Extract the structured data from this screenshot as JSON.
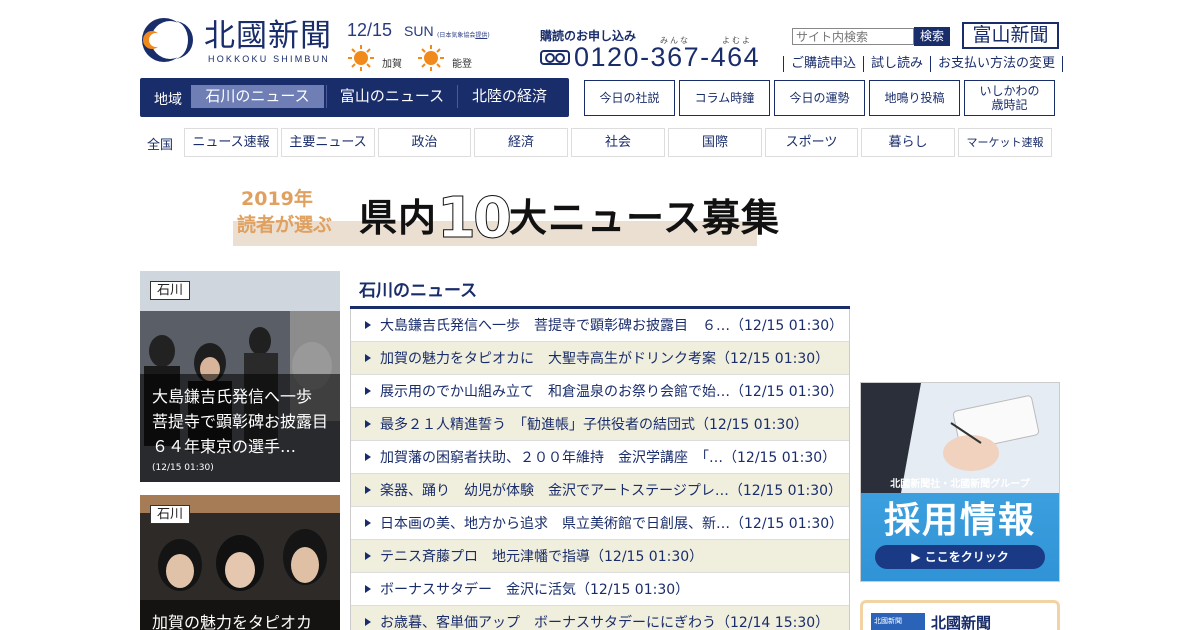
{
  "header": {
    "logo_text": "北國新聞",
    "logo_sub": "HOKKOKU SHIMBUN",
    "date": "12/15",
    "weekday": "SUN",
    "weather_source_prefix": "(日本気象協会",
    "weather_source_link": "提供",
    "weather_source_suffix": ")",
    "weather": [
      {
        "region": "加賀",
        "icon": "sun-icon"
      },
      {
        "region": "能登",
        "icon": "sun-icon"
      }
    ],
    "subscribe_label": "購読のお申し込み",
    "phone_ruby_1": "みんな",
    "phone_ruby_2": "よむよ",
    "phone": "0120-367-464",
    "search_placeholder": "サイト内検索",
    "search_button": "検索",
    "toyama_button": "富山新聞",
    "top_links": [
      "ご購読申込",
      "試し読み",
      "お支払い方法の変更"
    ]
  },
  "region_nav": {
    "label": "地域",
    "tabs": [
      "石川のニュース",
      "富山のニュース",
      "北陸の経済"
    ],
    "active_index": 0
  },
  "feature_buttons": [
    "今日の社説",
    "コラム時鐘",
    "今日の運勢",
    "地鳴り投稿",
    "いしかわの\n歳時記"
  ],
  "category_nav": {
    "label": "全国",
    "items": [
      "ニュース速報",
      "主要ニュース",
      "政治",
      "経済",
      "社会",
      "国際",
      "スポーツ",
      "暮らし",
      "マーケット速報"
    ]
  },
  "banner": {
    "year": "2019年",
    "sub": "読者が選ぶ",
    "main_prefix": "県内",
    "main_number": "10",
    "main_suffix": "大ニュース募集"
  },
  "photo_cards": [
    {
      "tag": "石川",
      "caption": "大島鎌吉氏発信へ一歩　菩提寺で顕彰碑お披露目　６４年東京の選手…",
      "time": "(12/15 01:30)"
    },
    {
      "tag": "石川",
      "caption": "加賀の魅力をタピオカ",
      "time": ""
    }
  ],
  "news": {
    "heading": "石川のニュース",
    "items": [
      "大島鎌吉氏発信へ一歩　菩提寺で顕彰碑お披露目　６…（12/15 01:30）",
      "加賀の魅力をタピオカに　大聖寺高生がドリンク考案（12/15 01:30）",
      "展示用のでか山組み立て　和倉温泉のお祭り会館で始…（12/15 01:30）",
      "最多２１人精進誓う　「勧進帳」子供役者の結団式（12/15 01:30）",
      "加賀藩の困窮者扶助、２００年維持　金沢学講座　「…（12/15 01:30）",
      "楽器、踊り　幼児が体験　金沢でアートステージプレ…（12/15 01:30）",
      "日本画の美、地方から追求　県立美術館で日創展、新…（12/15 01:30）",
      "テニス斉藤プロ　地元津幡で指導（12/15 01:30）",
      "ボーナスサタデー　金沢に活気（12/15 01:30）",
      "お歳暮、客単価アップ　ボーナスサタデーににぎわう（12/14 15:30）"
    ]
  },
  "ad": {
    "company": "北國新聞社・北國新聞グループ",
    "title": "採用情報",
    "button": "▶ ここをクリック"
  },
  "promo": {
    "logo_text": "北國新聞",
    "name": "北國新聞"
  },
  "colors": {
    "brand_navy": "#1a2d6b",
    "active_tab": "#6f7fb6",
    "row_alt": "#f0efde",
    "sun_orange": "#f08a1c"
  }
}
